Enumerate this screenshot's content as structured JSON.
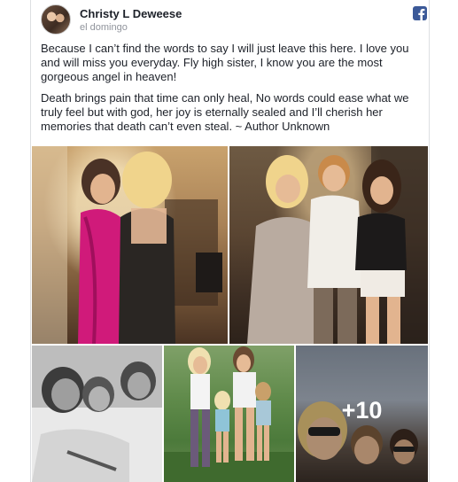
{
  "post": {
    "author": "Christy L Deweese",
    "date": "el domingo",
    "paragraph1": "Because I can’t find the words to say I will just leave this here. I love you and will miss you everyday. Fly high sister, I know you are the most gorgeous angel in heaven!",
    "paragraph2": "Death brings pain that time can only heal, No words could ease what we truly feel but with god, her joy is eternally sealed and I’ll cherish her memories that death can’t even steal. ~ Author Unknown",
    "more_photos_label": "+10"
  },
  "icons": {
    "platform": "facebook-icon"
  },
  "colors": {
    "facebook_blue": "#3b5998",
    "meta_text": "#90949c"
  }
}
